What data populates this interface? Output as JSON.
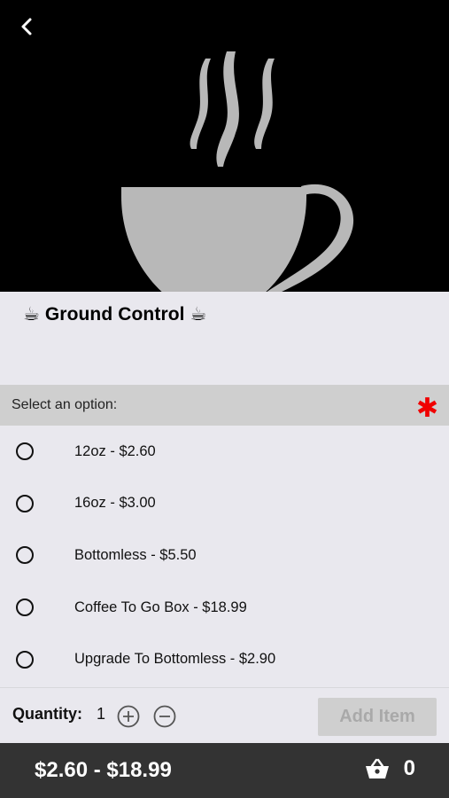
{
  "header": {
    "back_icon": "chevron-left-icon",
    "hero_image": "coffee-cup-steam-icon",
    "colors": {
      "hero_bg": "#000000",
      "cup": "#b8b8b8"
    }
  },
  "product": {
    "title": "Ground Control",
    "title_emoji": "☕"
  },
  "options": {
    "header_label": "Select an option:",
    "required_marker": "✱",
    "required_color": "#f00000",
    "items": [
      {
        "label": "12oz - $2.60",
        "selected": false
      },
      {
        "label": "16oz - $3.00",
        "selected": false
      },
      {
        "label": "Bottomless - $5.50",
        "selected": false
      },
      {
        "label": "Coffee To Go Box - $18.99",
        "selected": false
      },
      {
        "label": "Upgrade To Bottomless - $2.90",
        "selected": false
      }
    ]
  },
  "quantity": {
    "label": "Quantity:",
    "value": "1",
    "increment_icon": "plus-circle-icon",
    "decrement_icon": "minus-circle-icon"
  },
  "add_item": {
    "label": "Add Item",
    "enabled": false
  },
  "bottom_bar": {
    "price_range": "$2.60 - $18.99",
    "cart_icon": "basket-icon",
    "cart_count": "0",
    "bg_color": "#333333"
  }
}
